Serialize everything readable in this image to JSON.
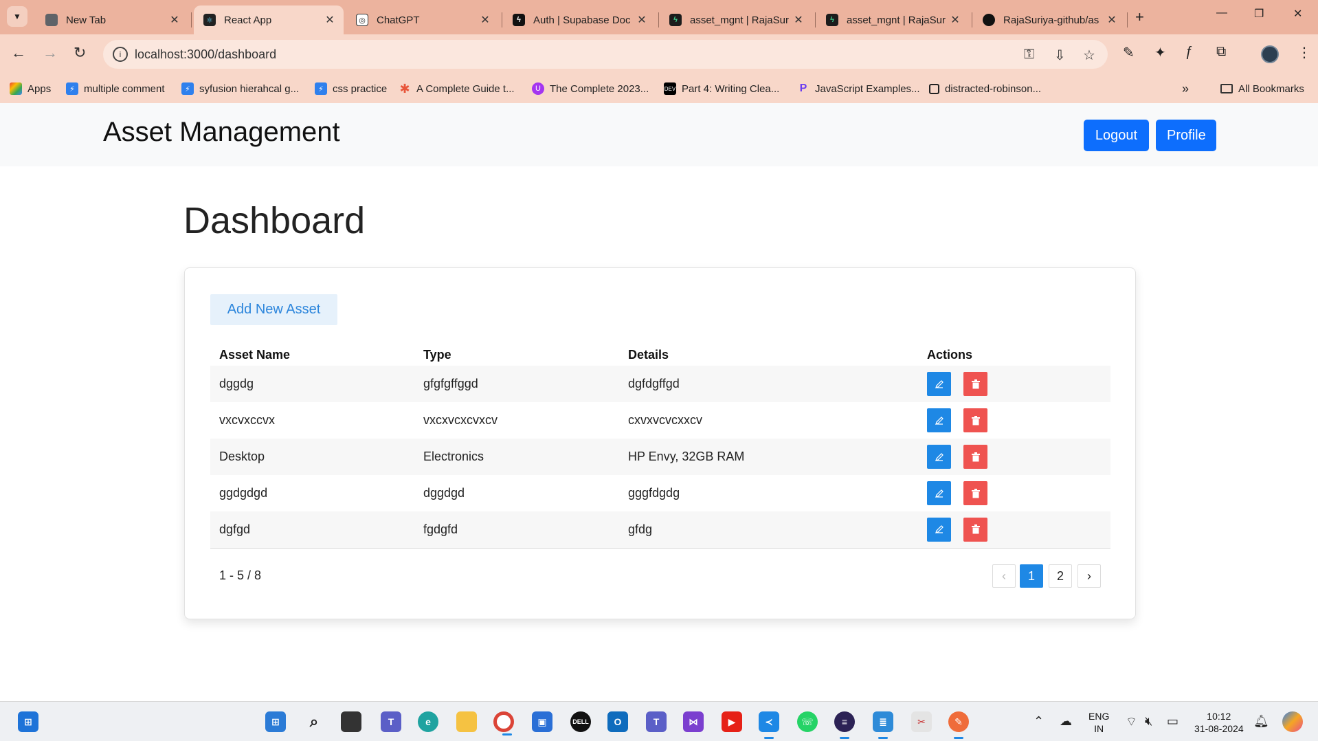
{
  "browser": {
    "tabs": [
      {
        "title": "New Tab",
        "icon": "chrome-icon"
      },
      {
        "title": "React App",
        "icon": "react-icon",
        "active": true
      },
      {
        "title": "ChatGPT",
        "icon": "openai-icon"
      },
      {
        "title": "Auth | Supabase Doc",
        "icon": "supabase-icon"
      },
      {
        "title": "asset_mgnt | RajaSur",
        "icon": "supabase-icon"
      },
      {
        "title": "asset_mgnt | RajaSur",
        "icon": "supabase-icon"
      },
      {
        "title": "RajaSuriya-github/as",
        "icon": "github-icon"
      }
    ],
    "url": "localhost:3000/dashboard",
    "bookmarks": [
      {
        "label": "Apps",
        "icon": "apps-grid-icon"
      },
      {
        "label": "multiple comment",
        "icon": "bolt-icon"
      },
      {
        "label": "syfusion hierahcal g...",
        "icon": "bolt-icon"
      },
      {
        "label": "css practice",
        "icon": "bolt-icon"
      },
      {
        "label": "A Complete Guide t...",
        "icon": "asterisk-icon"
      },
      {
        "label": "The Complete 2023...",
        "icon": "udemy-icon"
      },
      {
        "label": "Part 4: Writing Clea...",
        "icon": "dev-icon"
      },
      {
        "label": "JavaScript Examples...",
        "icon": "programiz-icon"
      },
      {
        "label": "distracted-robinson...",
        "icon": "square-icon"
      }
    ],
    "all_bookmarks_label": "All Bookmarks"
  },
  "app": {
    "brand": "Asset Management",
    "logout_label": "Logout",
    "profile_label": "Profile",
    "page_title": "Dashboard",
    "add_button_label": "Add New Asset",
    "columns": [
      "Asset Name",
      "Type",
      "Details",
      "Actions"
    ],
    "rows": [
      {
        "name": "dggdg",
        "type": "gfgfgffggd",
        "details": "dgfdgffgd"
      },
      {
        "name": "vxcvxccvx",
        "type": "vxcxvcxcvxcv",
        "details": "cxvxvcvcxxcv"
      },
      {
        "name": "Desktop",
        "type": "Electronics",
        "details": "HP Envy, 32GB RAM"
      },
      {
        "name": "ggdgdgd",
        "type": "dggdgd",
        "details": "gggfdgdg"
      },
      {
        "name": "dgfgd",
        "type": "fgdgfd",
        "details": "gfdg"
      }
    ],
    "pagination": {
      "range_text": "1 - 5 / 8",
      "pages": [
        "1",
        "2"
      ],
      "current_page": "1",
      "prev_symbol": "‹",
      "next_symbol": "›"
    },
    "colors": {
      "primary": "#0d6efd",
      "edit": "#1e88e5",
      "delete": "#ef5350",
      "add_bg": "#e6f1fb",
      "add_text": "#2d86dc"
    }
  },
  "taskbar": {
    "language_line1": "ENG",
    "language_line2": "IN",
    "time": "10:12",
    "date": "31-08-2024"
  }
}
